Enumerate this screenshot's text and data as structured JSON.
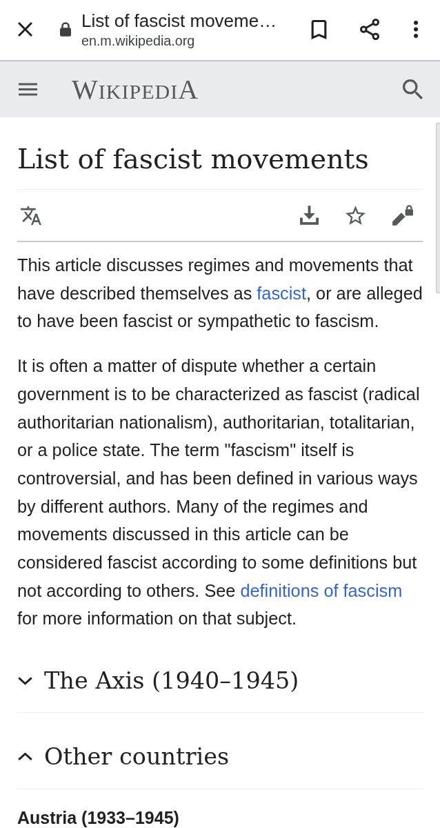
{
  "browser_bar": {
    "page_title": "List of fascist moveme…",
    "url": "en.m.wikipedia.org"
  },
  "site_header": {
    "wordmark": "WIKIPEDIA"
  },
  "article": {
    "title": "List of fascist movements",
    "paragraphs": [
      {
        "segments": [
          {
            "kind": "text",
            "text": "This article discusses regimes and movements that have described themselves as "
          },
          {
            "kind": "link",
            "text": "fascist"
          },
          {
            "kind": "text",
            "text": ", or are alleged to have been fascist or sympathetic to fascism."
          }
        ]
      },
      {
        "segments": [
          {
            "kind": "text",
            "text": "It is often a matter of dispute whether a certain government is to be characterized as fascist (radical authoritarian nationalism), authoritarian, totalitarian, or a police state. The term \"fascism\" itself is controversial, and has been defined in various ways by different authors. Many of the regimes and movements discussed in this article can be considered fascist according to some definitions but not according to others. See "
          },
          {
            "kind": "link",
            "text": "definitions of fascism"
          },
          {
            "kind": "text",
            "text": " for more information on that subject."
          }
        ]
      }
    ],
    "sections": [
      {
        "title": "The Axis (1940–1945)",
        "expanded": false
      },
      {
        "title": "Other countries",
        "expanded": true,
        "subheadings": [
          "Austria (1933–1945)"
        ]
      }
    ]
  }
}
